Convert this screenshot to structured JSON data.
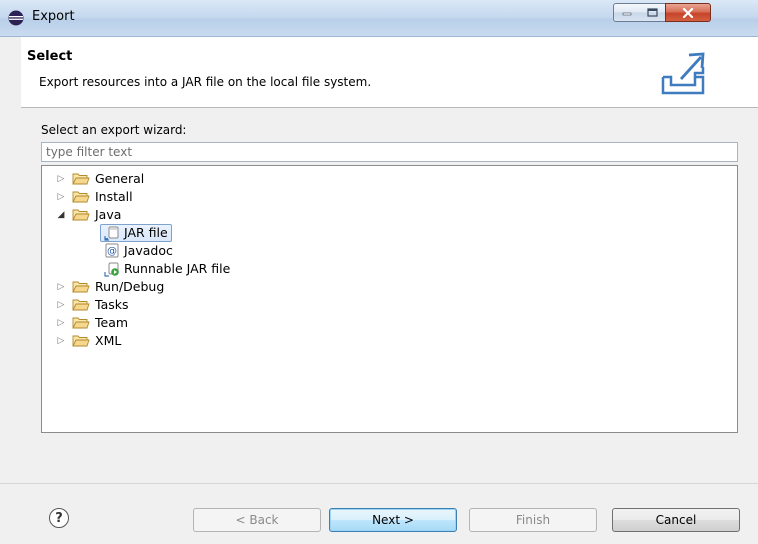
{
  "window": {
    "title": "Export"
  },
  "header": {
    "title": "Select",
    "description": "Export resources into a JAR file on the local file system."
  },
  "wizard": {
    "select_label": "Select an export wizard:",
    "filter_placeholder": "type filter text"
  },
  "tree": {
    "nodes": [
      {
        "label": "General",
        "expanded": false,
        "icon": "folder-icon"
      },
      {
        "label": "Install",
        "expanded": false,
        "icon": "folder-icon"
      },
      {
        "label": "Java",
        "expanded": true,
        "icon": "folder-icon",
        "children": [
          {
            "label": "JAR file",
            "selected": true,
            "icon": "jar-file-icon"
          },
          {
            "label": "Javadoc",
            "icon": "javadoc-icon"
          },
          {
            "label": "Runnable JAR file",
            "icon": "runnable-jar-icon"
          }
        ]
      },
      {
        "label": "Run/Debug",
        "expanded": false,
        "icon": "folder-icon"
      },
      {
        "label": "Tasks",
        "expanded": false,
        "icon": "folder-icon"
      },
      {
        "label": "Team",
        "expanded": false,
        "icon": "folder-icon"
      },
      {
        "label": "XML",
        "expanded": false,
        "icon": "folder-icon"
      }
    ]
  },
  "buttons": {
    "help": "?",
    "back": "< Back",
    "next": "Next >",
    "finish": "Finish",
    "cancel": "Cancel"
  },
  "colors": {
    "selection_border": "#7da2ce",
    "default_button": "#3c7fb1",
    "folder_fill": "#f5d78e"
  }
}
